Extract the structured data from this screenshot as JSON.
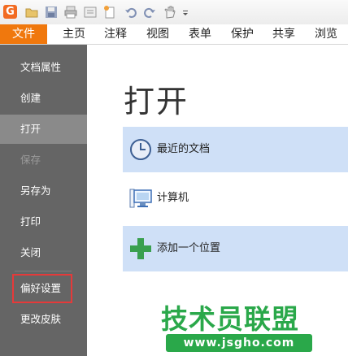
{
  "tabs": [
    {
      "label": "文件",
      "selected": true
    },
    {
      "label": "主页"
    },
    {
      "label": "注释"
    },
    {
      "label": "视图"
    },
    {
      "label": "表单"
    },
    {
      "label": "保护"
    },
    {
      "label": "共享"
    },
    {
      "label": "浏览"
    }
  ],
  "app_logo": "G",
  "menu": {
    "items": [
      {
        "label": "文档属性"
      },
      {
        "label": "创建"
      },
      {
        "label": "打开",
        "state": "selected"
      },
      {
        "label": "保存",
        "state": "disabled"
      },
      {
        "label": "另存为"
      },
      {
        "label": "打印"
      },
      {
        "label": "关闭"
      },
      {
        "label": "偏好设置",
        "state": "highlighted"
      },
      {
        "label": "更改皮肤"
      }
    ]
  },
  "main": {
    "title": "打开",
    "options": [
      {
        "label": "最近的文档",
        "icon": "clock-icon",
        "selected": true
      },
      {
        "label": "计算机",
        "icon": "computer-icon"
      },
      {
        "label": "添加一个位置",
        "icon": "plus-icon",
        "selected": true
      }
    ]
  },
  "watermark": {
    "line1": "技术员联盟",
    "line2": "www.jsgho.com"
  },
  "colors": {
    "file_tab": "#f0780d",
    "menu_bg": "#656565",
    "menu_selected": "#8a8a8a",
    "option_selected": "#cfe0f7",
    "highlight_border": "#e53a3a",
    "watermark": "#2aa84a"
  }
}
